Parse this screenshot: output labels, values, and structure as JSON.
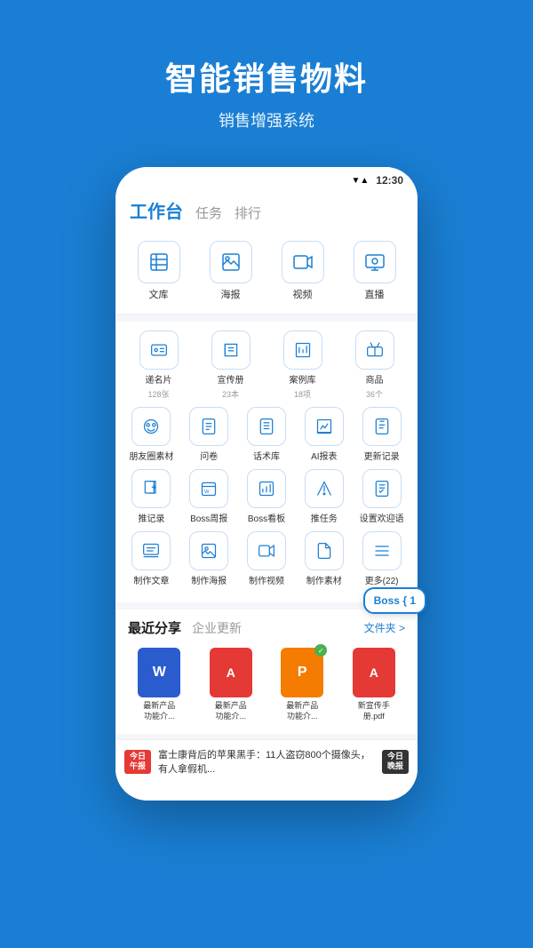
{
  "header": {
    "title": "智能销售物料",
    "subtitle": "销售增强系统"
  },
  "statusBar": {
    "time": "12:30",
    "wifiIcon": "▼",
    "signalIcon": "▲",
    "batteryIcon": "▮"
  },
  "topNav": {
    "title": "工作台",
    "items": [
      "任务",
      "排行"
    ]
  },
  "quickIcons": [
    {
      "label": "文库",
      "icon": "📄"
    },
    {
      "label": "海报",
      "icon": "🖼"
    },
    {
      "label": "视频",
      "icon": "▶"
    },
    {
      "label": "直播",
      "icon": "📺"
    }
  ],
  "gridRows": [
    [
      {
        "label": "递名片",
        "sub": "128张",
        "icon": "📇"
      },
      {
        "label": "宣传册",
        "sub": "23本",
        "icon": "📖"
      },
      {
        "label": "案例库",
        "sub": "18项",
        "icon": "📊"
      },
      {
        "label": "商品",
        "sub": "36个",
        "icon": "🛍"
      }
    ],
    [
      {
        "label": "朋友圈素材",
        "sub": "",
        "icon": "💬"
      },
      {
        "label": "问卷",
        "sub": "",
        "icon": "📋"
      },
      {
        "label": "话术库",
        "sub": "",
        "icon": "💬"
      },
      {
        "label": "AI报表",
        "sub": "",
        "icon": "📈"
      },
      {
        "label": "更新记录",
        "sub": "",
        "icon": "📝"
      }
    ],
    [
      {
        "label": "推记录",
        "sub": "",
        "icon": "📤"
      },
      {
        "label": "Boss周报",
        "sub": "",
        "icon": "📰"
      },
      {
        "label": "Boss看板",
        "sub": "",
        "icon": "📊"
      },
      {
        "label": "推任务",
        "sub": "",
        "icon": "🚩"
      },
      {
        "label": "设置欢迎语",
        "sub": "",
        "icon": "📋"
      }
    ],
    [
      {
        "label": "制作文章",
        "sub": "",
        "icon": "🖥"
      },
      {
        "label": "制作海报",
        "sub": "",
        "icon": "🖼"
      },
      {
        "label": "制作视频",
        "sub": "",
        "icon": "🎬"
      },
      {
        "label": "制作素材",
        "sub": "",
        "icon": "📄"
      },
      {
        "label": "更多(22)",
        "sub": "",
        "icon": "📦"
      }
    ]
  ],
  "section": {
    "activeTab": "最近分享",
    "inactiveTab": "企业更新",
    "link": "文件夹 >"
  },
  "fileCards": [
    {
      "type": "word",
      "label": "最新产品\n功能介...",
      "letter": "W",
      "checked": false
    },
    {
      "type": "pdf",
      "label": "最新产品\n功能介...",
      "letter": "A",
      "checked": false
    },
    {
      "type": "ppt",
      "label": "最新产品\n功能介...",
      "letter": "P",
      "checked": true
    },
    {
      "type": "pdf2",
      "label": "新宣传手\n册.pdf",
      "letter": "A",
      "checked": false
    }
  ],
  "newsItems": [
    {
      "badge": "今日\n午报",
      "text": "富士康背后的苹果黑手：11人盗窃800个摄像头，有人拿假机...",
      "badgeRight": "今日\n晚报"
    }
  ],
  "bossBadge": "Boss { 1"
}
